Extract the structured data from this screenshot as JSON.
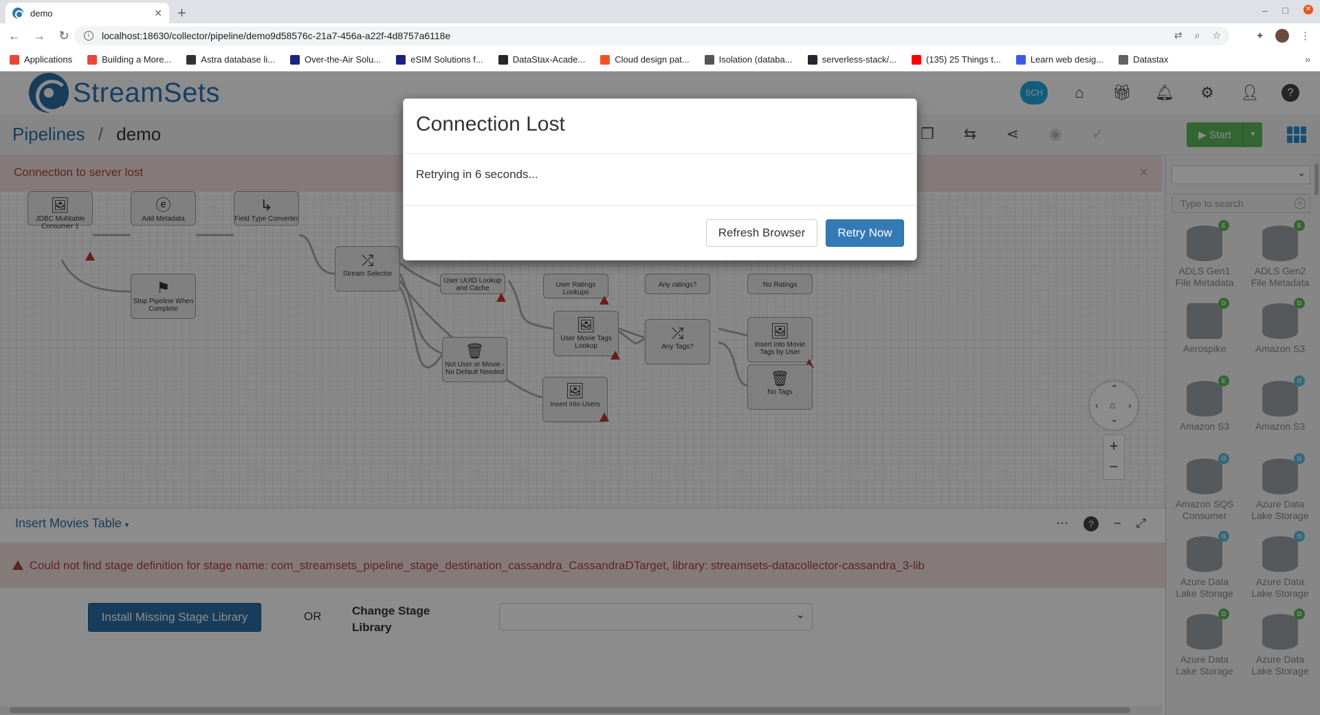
{
  "browser": {
    "tab_title": "demo",
    "url": "localhost:18630/collector/pipeline/demo9d58576c-21a7-456a-a22f-4d8757a6118e",
    "bookmarks": [
      {
        "label": "Applications",
        "color": "#e8453c"
      },
      {
        "label": "Building a More...",
        "color": "#e8453c"
      },
      {
        "label": "Astra database li...",
        "color": "#333333"
      },
      {
        "label": "Over-the-Air Solu...",
        "color": "#1a237e"
      },
      {
        "label": "eSIM Solutions f...",
        "color": "#1a237e"
      },
      {
        "label": "DataStax-Acade...",
        "color": "#24292e"
      },
      {
        "label": "Cloud design pat...",
        "color": "#f25022"
      },
      {
        "label": "Isolation (databa...",
        "color": "#555555"
      },
      {
        "label": "serverless-stack/...",
        "color": "#24292e"
      },
      {
        "label": "(135) 25 Things t...",
        "color": "#ff0000"
      },
      {
        "label": "Learn web desig...",
        "color": "#3c5ce6"
      },
      {
        "label": "Datastax",
        "color": "#5f6368"
      }
    ]
  },
  "app": {
    "brand": "StreamSets",
    "sch_label": "SCH",
    "breadcrumb": {
      "root": "Pipelines",
      "current": "demo"
    },
    "start_label": "Start",
    "alert_text": "Connection to server lost",
    "canvas_nodes": [
      {
        "label": "JDBC Multitable Consumer 1"
      },
      {
        "label": "Add Metadata"
      },
      {
        "label": "Field Type Converter"
      },
      {
        "label": "Stream Selector"
      },
      {
        "label": "Stop Pipeline When Complete"
      },
      {
        "label": "User UUID Lookup and Cache"
      },
      {
        "label": "User Ratings Lookups"
      },
      {
        "label": "Any ratings?"
      },
      {
        "label": "No Ratings"
      },
      {
        "label": "User Movie Tags Lookup"
      },
      {
        "label": "Any Tags?"
      },
      {
        "label": "Insert into Movie Tags by User"
      },
      {
        "label": "Not User or Movie - No Default Needed"
      },
      {
        "label": "No Tags"
      },
      {
        "label": "Insert into Users"
      }
    ],
    "bottom_panel": {
      "title": "Insert Movies Table",
      "error": "Could not find stage definition for stage name: com_streamsets_pipeline_stage_destination_cassandra_CassandraDTarget, library: streamsets-datacollector-cassandra_3-lib",
      "install_label": "Install Missing Stage Library",
      "or_label": "OR",
      "change_label": "Change Stage Library"
    },
    "library": {
      "search_placeholder": "Type to search",
      "stages": [
        {
          "label": "ADLS Gen1 File Metadata",
          "badge": "E",
          "badge_color": "#5cb85c"
        },
        {
          "label": "ADLS Gen2 File Metadata",
          "badge": "E",
          "badge_color": "#5cb85c"
        },
        {
          "label": "Aerospike",
          "badge": "D",
          "badge_color": "#5cb85c"
        },
        {
          "label": "Amazon S3",
          "badge": "D",
          "badge_color": "#5cb85c"
        },
        {
          "label": "Amazon S3",
          "badge": "E",
          "badge_color": "#5cb85c"
        },
        {
          "label": "Amazon S3",
          "badge": "O",
          "badge_color": "#5bc0de"
        },
        {
          "label": "Amazon SQS Consumer",
          "badge": "O",
          "badge_color": "#5bc0de"
        },
        {
          "label": "Azure Data Lake Storage",
          "badge": "O",
          "badge_color": "#5bc0de"
        },
        {
          "label": "Azure Data Lake Storage",
          "badge": "O",
          "badge_color": "#5bc0de"
        },
        {
          "label": "Azure Data Lake Storage",
          "badge": "O",
          "badge_color": "#5bc0de"
        },
        {
          "label": "Azure Data Lake Storage",
          "badge": "D",
          "badge_color": "#5cb85c"
        },
        {
          "label": "Azure Data Lake Storage",
          "badge": "D",
          "badge_color": "#5cb85c"
        }
      ]
    }
  },
  "modal": {
    "title": "Connection Lost",
    "body": "Retrying in 6 seconds...",
    "refresh_label": "Refresh Browser",
    "retry_label": "Retry Now"
  }
}
